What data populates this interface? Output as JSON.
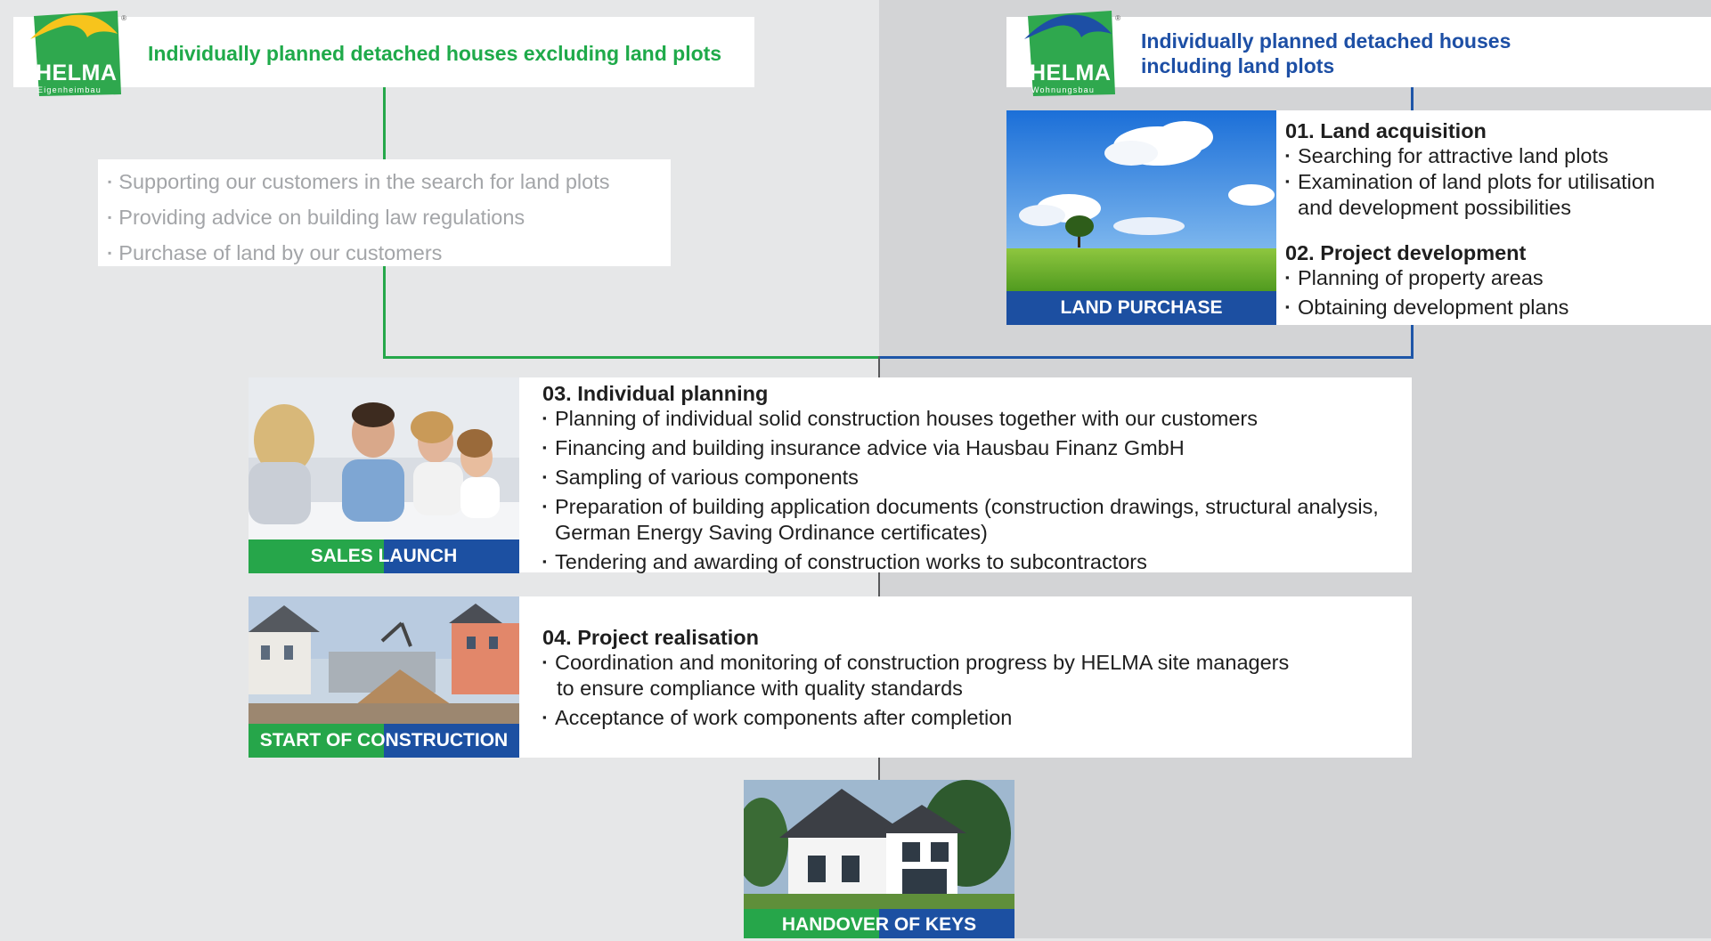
{
  "left_header": {
    "logo_name": "HELMA",
    "logo_sub": "Eigenheimbau",
    "title": "Individually planned detached houses excluding land plots",
    "color": "#1faa4a"
  },
  "right_header": {
    "logo_name": "HELMA",
    "logo_sub": "Wohnungsbau",
    "title_line1": "Individually planned detached houses",
    "title_line2": "including land plots",
    "color": "#1d4fa5"
  },
  "logo_registered": "®",
  "left_services": [
    "Supporting our customers in the search for land plots",
    "Providing advice on building law regulations",
    "Purchase of land by our customers"
  ],
  "land_purchase": {
    "label": "LAND PURCHASE",
    "step1_title": "01. Land acquisition",
    "step1_items": [
      "Searching for attractive land plots",
      "Examination of land plots for utilisation",
      "and development possibilities"
    ],
    "step2_title": "02. Project development",
    "step2_items": [
      "Planning of property areas",
      "Obtaining development plans"
    ]
  },
  "sales_launch": {
    "label": "SALES LAUNCH",
    "title": "03. Individual planning",
    "items": [
      "Planning of individual solid construction houses together with our customers",
      "Financing and building insurance advice via Hausbau Finanz GmbH",
      "Sampling of various components",
      "Preparation of building application documents (construction drawings, structural analysis,",
      "German Energy Saving Ordinance certificates)",
      "Tendering and awarding of construction works to subcontractors"
    ]
  },
  "construction": {
    "label": "START OF CONSTRUCTION",
    "title": "04. Project realisation",
    "items": [
      "Coordination and monitoring of construction progress by HELMA site managers",
      "to ensure compliance with quality standards",
      "Acceptance of work components after completion"
    ]
  },
  "handover": {
    "label": "HANDOVER OF KEYS"
  },
  "colors": {
    "green": "#25a84a",
    "blue": "#1c50a2",
    "left_bg": "#e6e7e8",
    "right_bg": "#d3d4d6"
  }
}
